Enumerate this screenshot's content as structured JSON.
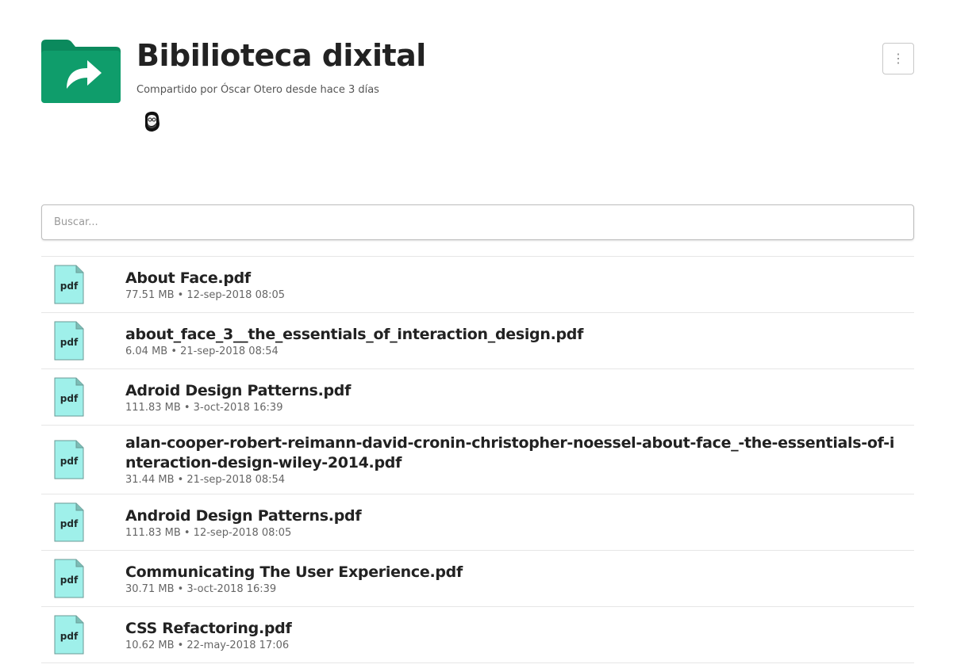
{
  "header": {
    "title": "Bibilioteca dixital",
    "subtitle": "Compartido por Óscar Otero desde hace 3 días",
    "menu_glyph": "⋮",
    "folder_icon": "shared-folder-icon",
    "folder_color": "#0f9d6b"
  },
  "search": {
    "placeholder": "Buscar...",
    "value": ""
  },
  "files": [
    {
      "name": "About Face.pdf",
      "size": "77.51 MB",
      "date": "12-sep-2018 08:05",
      "info": "77.51 MB • 12-sep-2018 08:05",
      "icon_label": "pdf"
    },
    {
      "name": "about_face_3__the_essentials_of_interaction_design.pdf",
      "size": "6.04 MB",
      "date": "21-sep-2018 08:54",
      "info": "6.04 MB • 21-sep-2018 08:54",
      "icon_label": "pdf"
    },
    {
      "name": "Adroid Design Patterns.pdf",
      "size": "111.83 MB",
      "date": "3-oct-2018 16:39",
      "info": "111.83 MB • 3-oct-2018 16:39",
      "icon_label": "pdf"
    },
    {
      "name": "alan-cooper-robert-reimann-david-cronin-christopher-noessel-about-face_-the-essentials-of-interaction-design-wiley-2014.pdf",
      "size": "31.44 MB",
      "date": "21-sep-2018 08:54",
      "info": "31.44 MB • 21-sep-2018 08:54",
      "icon_label": "pdf"
    },
    {
      "name": "Android Design Patterns.pdf",
      "size": "111.83 MB",
      "date": "12-sep-2018 08:05",
      "info": "111.83 MB • 12-sep-2018 08:05",
      "icon_label": "pdf"
    },
    {
      "name": "Communicating The User Experience.pdf",
      "size": "30.71 MB",
      "date": "3-oct-2018 16:39",
      "info": "30.71 MB • 3-oct-2018 16:39",
      "icon_label": "pdf"
    },
    {
      "name": "CSS Refactoring.pdf",
      "size": "10.62 MB",
      "date": "22-may-2018 17:06",
      "info": "10.62 MB • 22-may-2018 17:06",
      "icon_label": "pdf"
    }
  ],
  "colors": {
    "pdf_icon_fill": "#9ff0ea",
    "pdf_icon_stroke": "#6a9a96",
    "folder_green": "#0f9d6b"
  }
}
